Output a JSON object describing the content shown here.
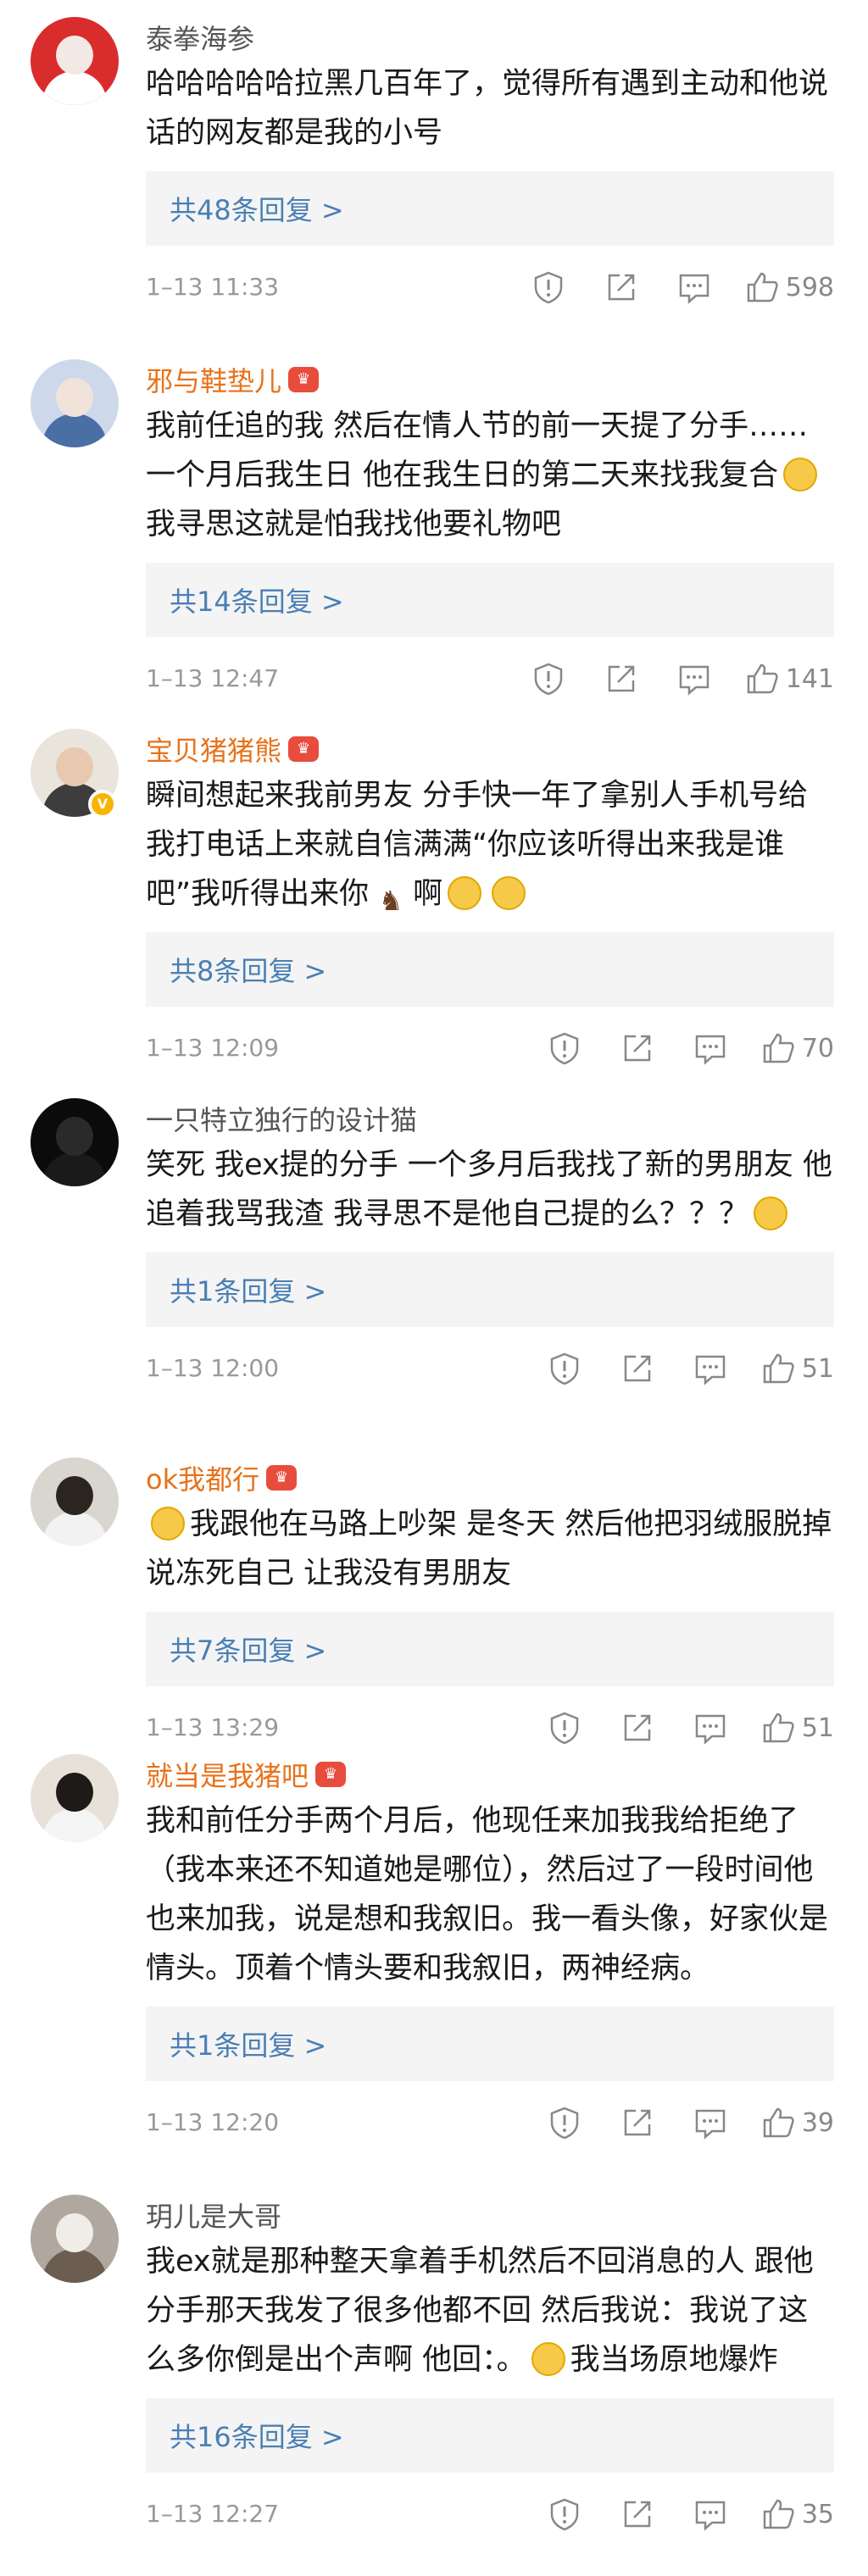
{
  "reply_unit": "条回复",
  "comments": [
    {
      "user": "泰拳海参",
      "vip": false,
      "verified": false,
      "avatar": {
        "bg": "#d92c2c",
        "face": "#f3e9e4",
        "body": "#ffffff"
      },
      "text": "哈哈哈哈哈拉黑几百年了，觉得所有遇到主动和他说话的网友都是我的小号",
      "emoji_after": [],
      "replies_label": "共48条回复 >",
      "time": "1–13 11:33",
      "likes": "598"
    },
    {
      "user": "邪与鞋垫儿",
      "vip": true,
      "verified": false,
      "avatar": {
        "bg": "#cdd9ea",
        "face": "#f2e3da",
        "body": "#4a6fa5"
      },
      "text": "我前任追的我 然后在情人节的前一天提了分手……一个月后我生日 他在我生日的第二天来找我复合",
      "emoji_after_text": "我寻思这就是怕我找他要礼物吧",
      "replies_label": "共14条回复 >",
      "time": "1–13 12:47",
      "likes": "141"
    },
    {
      "user": "宝贝猪猪熊",
      "vip": true,
      "verified": true,
      "avatar": {
        "bg": "#e9e4dc",
        "face": "#e8c9b0",
        "body": "#3d3d3d"
      },
      "text_a": "瞬间想起来我前男友 分手快一年了拿别人手机号给我打电话上来就自信满满“你应该听得出来我是谁吧”我听得出来你",
      "text_b": "啊",
      "replies_label": "共8条回复 >",
      "time": "1–13 12:09",
      "likes": "70"
    },
    {
      "user": "一只特立独行的设计猫",
      "vip": false,
      "verified": false,
      "avatar": {
        "bg": "#0b0b0b",
        "face": "#2a2a2a",
        "body": "#1a1a1a"
      },
      "text": "笑死 我ex提的分手 一个多月后我找了新的男朋友 他追着我骂我渣 我寻思不是他自己提的么？？？",
      "replies_label": "共1条回复 >",
      "time": "1–13 12:00",
      "likes": "51"
    },
    {
      "user": "ok我都行",
      "vip": true,
      "verified": false,
      "avatar": {
        "bg": "#d9d6cf",
        "face": "#2b2520",
        "body": "#f2f2f2"
      },
      "text": "我跟他在马路上吵架 是冬天 然后他把羽绒服脱掉说冻死自己 让我没有男朋友",
      "replies_label": "共7条回复 >",
      "time": "1–13 13:29",
      "likes": "51"
    },
    {
      "user": "就当是我猪吧",
      "vip": true,
      "verified": false,
      "avatar": {
        "bg": "#e7e1da",
        "face": "#1e1a17",
        "body": "#f5f5f5"
      },
      "text": "我和前任分手两个月后，他现任来加我我给拒绝了（我本来还不知道她是哪位），然后过了一段时间他也来加我，说是想和我叙旧。我一看头像，好家伙是情头。顶着个情头要和我叙旧，两神经病。",
      "replies_label": "共1条回复 >",
      "time": "1–13 12:20",
      "likes": "39"
    },
    {
      "user": "玥儿是大哥",
      "vip": false,
      "verified": false,
      "avatar": {
        "bg": "#b0a89e",
        "face": "#f0ede8",
        "body": "#6b5d50"
      },
      "text_a": "我ex就是那种整天拿着手机然后不回消息的人 跟他分手那天我发了很多他都不回 然后我说：我说了这么多你倒是出个声啊 他回：。",
      "text_b": "我当场原地爆炸",
      "replies_label": "共16条回复 >",
      "time": "1–13 12:27",
      "likes": "35"
    }
  ]
}
